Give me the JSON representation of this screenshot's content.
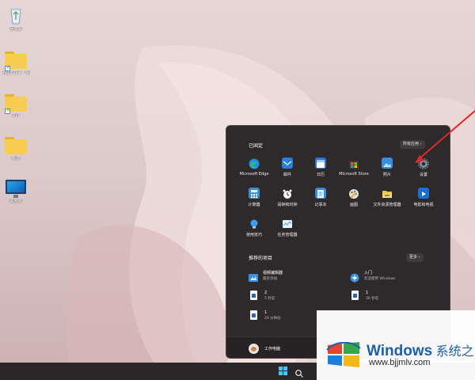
{
  "desktop": {
    "icons": [
      {
        "label": "回收站",
        "icon": "recycle-bin-icon"
      },
      {
        "label": "新建文件夹 - 快捷方式",
        "icon": "folder-icon"
      },
      {
        "label": "文件",
        "icon": "folder-icon"
      },
      {
        "label": "新建",
        "icon": "folder-icon"
      },
      {
        "label": "此电脑",
        "icon": "this-pc-icon"
      }
    ]
  },
  "start_menu": {
    "pinned_title": "已固定",
    "all_apps_label": "所有应用  ›",
    "pinned_apps": [
      {
        "label": "Microsoft Edge",
        "icon": "edge-icon",
        "color": "#1f8fe0"
      },
      {
        "label": "邮件",
        "icon": "mail-icon",
        "color": "#2a7fd6"
      },
      {
        "label": "日历",
        "icon": "calendar-icon",
        "color": "#2e77d0"
      },
      {
        "label": "Microsoft Store",
        "icon": "store-icon",
        "color": "#f2f2f2"
      },
      {
        "label": "照片",
        "icon": "photos-icon",
        "color": "#3a8fe0"
      },
      {
        "label": "设置",
        "icon": "settings-gear-icon",
        "color": "#7d8ea3"
      },
      {
        "label": "计算器",
        "icon": "calculator-icon",
        "color": "#3a8fd6"
      },
      {
        "label": "闹钟和时钟",
        "icon": "alarm-clock-icon",
        "color": "#e8e8e8"
      },
      {
        "label": "记事本",
        "icon": "notepad-icon",
        "color": "#2f8ee6"
      },
      {
        "label": "画图",
        "icon": "paint-icon",
        "color": "#f0a63a"
      },
      {
        "label": "文件资源管理器",
        "icon": "file-explorer-icon",
        "color": "#f2c140"
      },
      {
        "label": "电影和电视",
        "icon": "movies-tv-icon",
        "color": "#1a6fd1"
      },
      {
        "label": "使用技巧",
        "icon": "tips-icon",
        "color": "#3b9cf0"
      },
      {
        "label": "任务管理器",
        "icon": "task-manager-icon",
        "color": "#4aa3e8"
      }
    ],
    "recommended_title": "推荐的项目",
    "more_label": "更多  ›",
    "recommended": [
      {
        "name": "视频编辑器",
        "sub": "最近添加",
        "icon": "video-editor-icon"
      },
      {
        "name": "入门",
        "sub": "欢迎使用 Windows",
        "icon": "get-started-icon"
      },
      {
        "name": "2",
        "sub": "5 秒前",
        "icon": "document-icon"
      },
      {
        "name": "1",
        "sub": "36 秒前",
        "icon": "document-icon"
      },
      {
        "name": "1",
        "sub": "29 分钟前",
        "icon": "document-icon"
      }
    ],
    "user_name": "工作电脑"
  },
  "watermark": {
    "title": "Windows",
    "title_cn": " 系统之家",
    "url": "www.bjjmlv.com"
  }
}
